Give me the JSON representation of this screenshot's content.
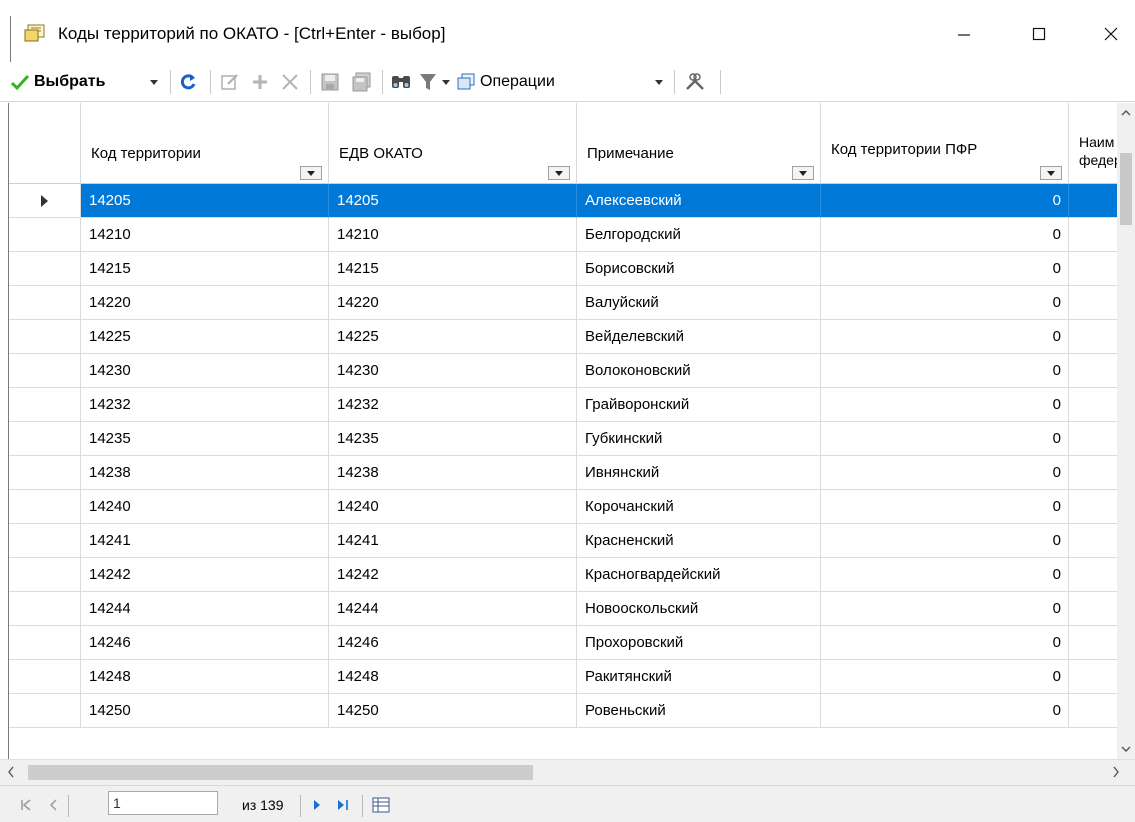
{
  "window": {
    "title": "Коды территорий по ОКАТО - [Ctrl+Enter - выбор]",
    "min_icon": "minimize-icon",
    "max_icon": "maximize-icon",
    "close_icon": "close-icon"
  },
  "toolbar": {
    "select_label": "Выбрать",
    "operations_label": "Операции",
    "accent_green": "#33b51f",
    "icons": [
      "checkmark-icon",
      "refresh-icon",
      "edit-icon",
      "add-icon",
      "delete-icon",
      "save-icon",
      "save-all-icon",
      "find-icon",
      "filter-icon",
      "operations-icon",
      "tools-icon"
    ]
  },
  "grid": {
    "columns": [
      "Код территории",
      "ЕДВ ОКАТО",
      "Примечание",
      "Код территории ПФР",
      "Наим федер"
    ],
    "selected_row": 0,
    "selection_color": "#0078d7",
    "rows": [
      {
        "code": "14205",
        "okato": "14205",
        "note": "Алексеевский",
        "pfr": "0"
      },
      {
        "code": "14210",
        "okato": "14210",
        "note": "Белгородский",
        "pfr": "0"
      },
      {
        "code": "14215",
        "okato": "14215",
        "note": "Борисовский",
        "pfr": "0"
      },
      {
        "code": "14220",
        "okato": "14220",
        "note": "Валуйский",
        "pfr": "0"
      },
      {
        "code": "14225",
        "okato": "14225",
        "note": "Вейделевский",
        "pfr": "0"
      },
      {
        "code": "14230",
        "okato": "14230",
        "note": "Волоконовский",
        "pfr": "0"
      },
      {
        "code": "14232",
        "okato": "14232",
        "note": "Грайворонский",
        "pfr": "0"
      },
      {
        "code": "14235",
        "okato": "14235",
        "note": "Губкинский",
        "pfr": "0"
      },
      {
        "code": "14238",
        "okato": "14238",
        "note": "Ивнянский",
        "pfr": "0"
      },
      {
        "code": "14240",
        "okato": "14240",
        "note": "Корочанский",
        "pfr": "0"
      },
      {
        "code": "14241",
        "okato": "14241",
        "note": "Красненский",
        "pfr": "0"
      },
      {
        "code": "14242",
        "okato": "14242",
        "note": "Красногвардейский",
        "pfr": "0"
      },
      {
        "code": "14244",
        "okato": "14244",
        "note": "Новооскольский",
        "pfr": "0"
      },
      {
        "code": "14246",
        "okato": "14246",
        "note": "Прохоровский",
        "pfr": "0"
      },
      {
        "code": "14248",
        "okato": "14248",
        "note": "Ракитянский",
        "pfr": "0"
      },
      {
        "code": "14250",
        "okato": "14250",
        "note": "Ровеньский",
        "pfr": "0"
      }
    ]
  },
  "navigator": {
    "position": "1",
    "total_label": "из 139"
  }
}
